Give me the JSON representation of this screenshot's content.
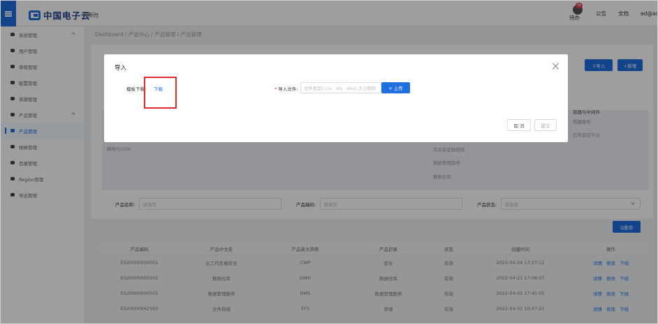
{
  "header": {
    "logo_text": "中国电子云",
    "console": "控制台",
    "todo_badge": "99",
    "todo": "待办",
    "notice": "公告",
    "docs": "文档",
    "user": "ad@admin"
  },
  "sidebar": {
    "items": [
      {
        "label": "系统管理"
      },
      {
        "label": "用户管理"
      },
      {
        "label": "审核管理"
      },
      {
        "label": "配置管理"
      },
      {
        "label": "资源管理"
      },
      {
        "label": "产品管理"
      },
      {
        "label": "产品管理"
      },
      {
        "label": "规格管理"
      },
      {
        "label": "目录管理"
      },
      {
        "label": "Region管理"
      },
      {
        "label": "导出管理"
      }
    ]
  },
  "breadcrumb": "Dashboard / 产品中心 / 产品管理 / 产品管理",
  "toolbar": {
    "import": "⇪导入",
    "add": "+新增"
  },
  "categories": {
    "network": "网络与CDN",
    "db1": "非关系型数据库",
    "db2": "数据管理服务",
    "db3": "数据仓库",
    "container_title": "容器与中间件",
    "container1": "容器服务",
    "container2": "应用监控平台"
  },
  "filters": {
    "name_label": "产品名称:",
    "name_placeholder": "请填写",
    "code_label": "产品编码:",
    "code_placeholder": "请填写",
    "status_label": "产品状态:",
    "status_placeholder": "请选择",
    "search": "Q查询"
  },
  "table": {
    "headers": [
      "产品编码",
      "产品中文名",
      "产品英文简称",
      "产品目录",
      "状态",
      "创建时间",
      "操作"
    ],
    "rows": [
      [
        "ES20000000001",
        "云工作负载安全",
        "CWP",
        "安全",
        "有效",
        "2022-04-24 17:27:11"
      ],
      [
        "ES20000000502",
        "数据仓库",
        "DWH",
        "数据仓库",
        "有效",
        "2022-04-21 17:08:07"
      ],
      [
        "ES20000000501",
        "数据管理服务",
        "DMS",
        "数据管理服务",
        "有效",
        "2022-04-02 17:45:05"
      ],
      [
        "ES20000042503",
        "文件存储",
        "EFS",
        "存储",
        "有效",
        "2022-04-02 10:47:21"
      ]
    ],
    "ops": [
      "详情",
      "修改",
      "下线"
    ]
  },
  "modal": {
    "title": "导入",
    "template_label": "模板下载:",
    "template_link": "下载",
    "file_label": "导入文件:",
    "file_placeholder": "文件类型(.csv, .xls, .xlsx),大小限制",
    "upload": "+ 上传",
    "cancel": "取 消",
    "submit": "提交"
  },
  "colors": {
    "primary": "#1f6fe0",
    "highlight": "#e02c2c"
  }
}
